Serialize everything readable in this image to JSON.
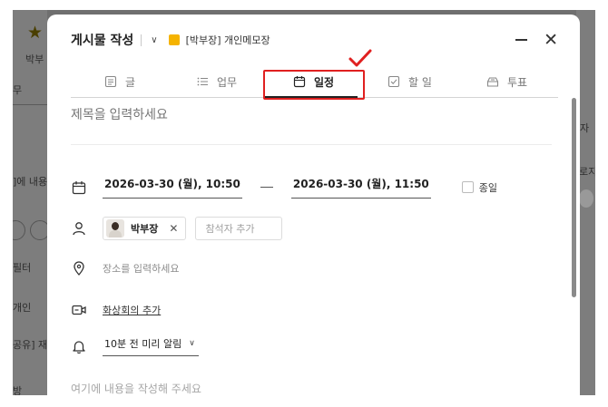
{
  "background": {
    "left_texts": [
      "박부",
      "무",
      "]에 내용",
      "필터",
      "개인",
      "공유] 재",
      "방"
    ],
    "right_texts": [
      "자",
      "로지"
    ]
  },
  "modal": {
    "title": "게시물 작성",
    "board_color": "#f5b300",
    "board_name": "[박부장] 개인메모장",
    "icons": {
      "minimize": "minus-icon",
      "close": "close-icon"
    }
  },
  "tabs": [
    {
      "label": "글",
      "icon": "document-icon",
      "active": false
    },
    {
      "label": "업무",
      "icon": "list-icon",
      "active": false
    },
    {
      "label": "일정",
      "icon": "calendar-icon",
      "active": true
    },
    {
      "label": "할 일",
      "icon": "checkbox-icon",
      "active": false
    },
    {
      "label": "투표",
      "icon": "vote-icon",
      "active": false
    }
  ],
  "annotation": {
    "color": "#e02020",
    "target_tab": "일정"
  },
  "form": {
    "title_placeholder": "제목을 입력하세요",
    "start_datetime": "2026-03-30 (월), 10:50",
    "end_datetime": "2026-03-30 (월), 11:50",
    "all_day_label": "종일",
    "all_day_checked": false,
    "attendee_name": "박부장",
    "attendee_add_placeholder": "참석자 추가",
    "place_placeholder": "장소를 입력하세요",
    "video_label": "화상회의 추가",
    "alarm_value": "10분 전 미리 알림",
    "body_placeholder": "여기에 내용을 작성해 주세요"
  }
}
